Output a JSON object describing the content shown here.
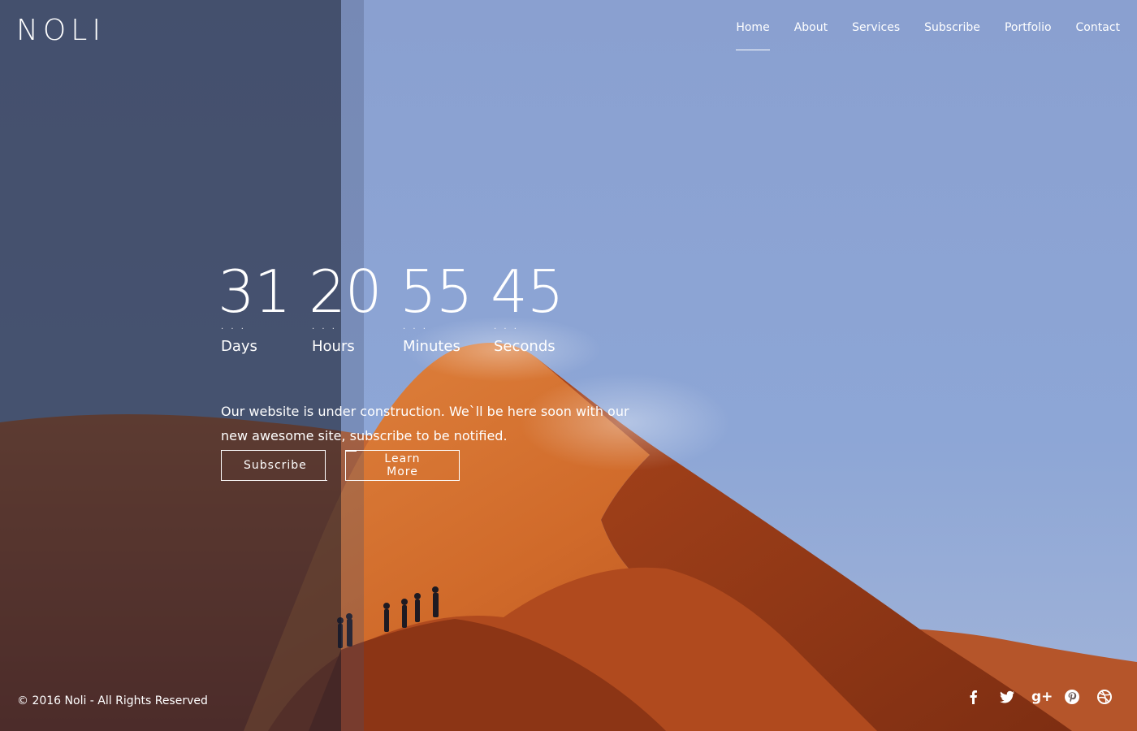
{
  "brand": {
    "logo": "NOLI"
  },
  "nav": {
    "items": [
      {
        "label": "Home"
      },
      {
        "label": "About"
      },
      {
        "label": "Services"
      },
      {
        "label": "Subscribe"
      },
      {
        "label": "Portfolio"
      },
      {
        "label": "Contact"
      }
    ],
    "active": "Home"
  },
  "countdown": {
    "days": {
      "value": "31",
      "label": "Days"
    },
    "hours": {
      "value": "20",
      "label": "Hours"
    },
    "minutes": {
      "value": "55",
      "label": "Minutes"
    },
    "seconds": {
      "value": "45",
      "label": "Seconds"
    },
    "dots": "· · ·"
  },
  "message": "Our website is under construction. We`ll be here soon with our new awesome site, subscribe to be notified.",
  "buttons": {
    "subscribe": "Subscribe",
    "learn_more": "Learn More"
  },
  "footer": {
    "copyright": "© 2016 Noli - All Rights Reserved",
    "social": [
      "facebook-icon",
      "twitter-icon",
      "google-plus-icon",
      "pinterest-icon",
      "dribbble-icon"
    ],
    "google_plus_glyph": "g+"
  },
  "colors": {
    "sky": "#8aa2d2",
    "dune": "#c85a22",
    "dune_shadow": "#8a3418",
    "panel": "#1a1e30"
  }
}
